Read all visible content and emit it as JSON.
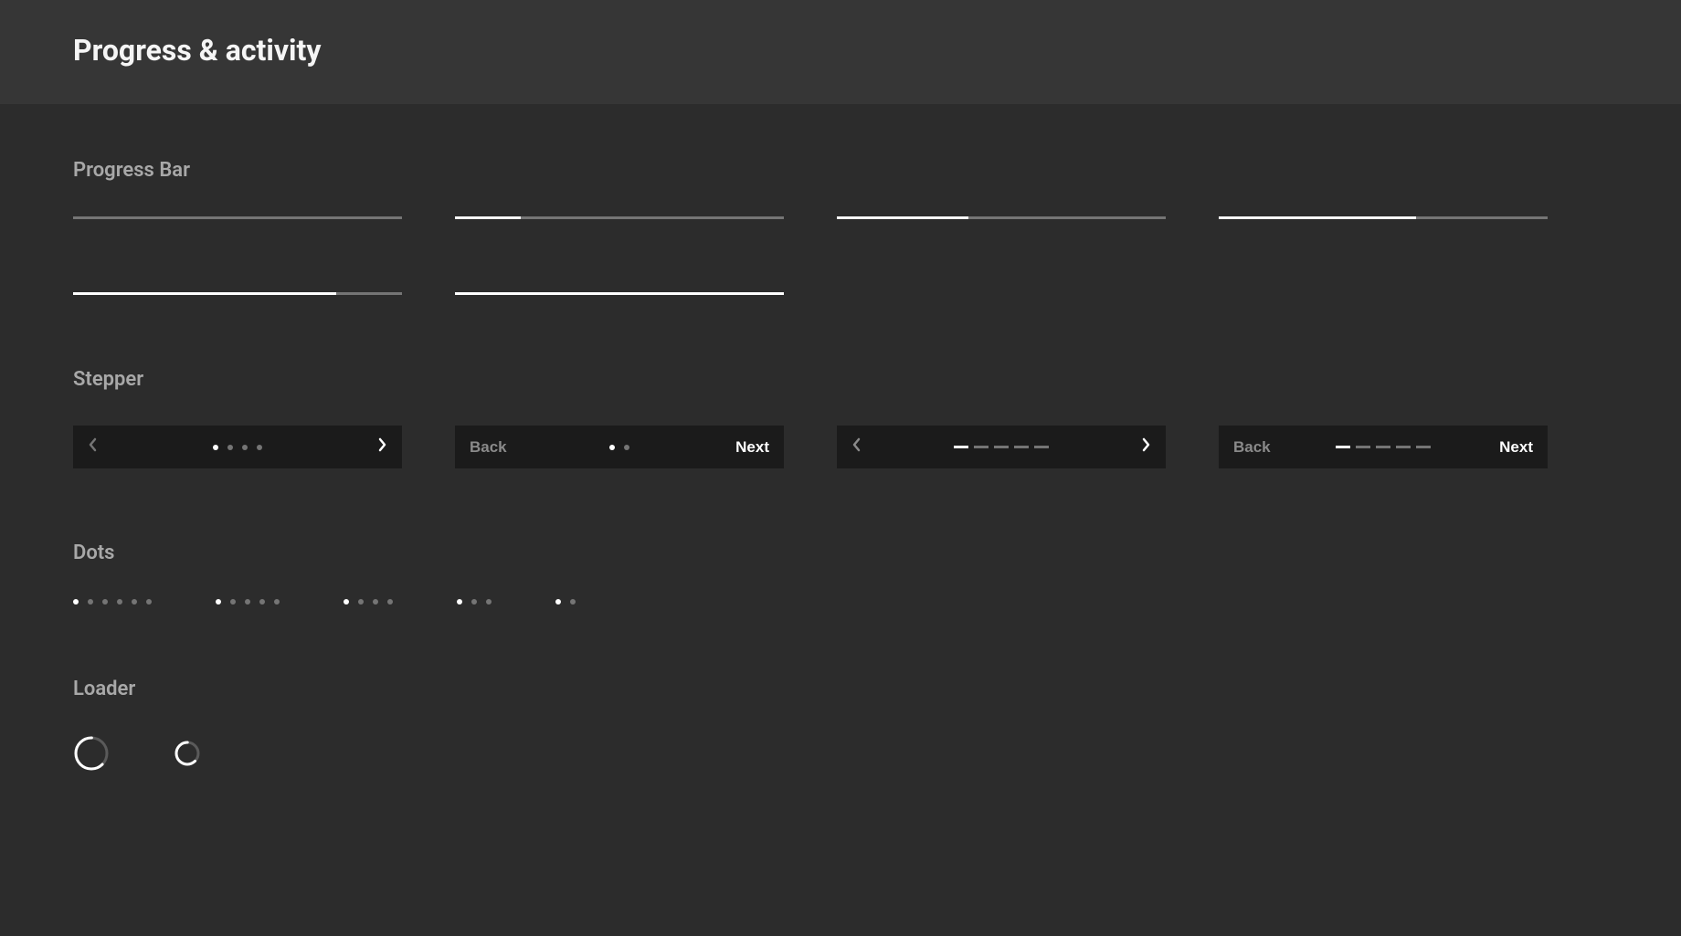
{
  "header": {
    "title": "Progress & activity"
  },
  "sections": {
    "progress_bar": {
      "title": "Progress Bar",
      "items": [
        {
          "percent": 0
        },
        {
          "percent": 20
        },
        {
          "percent": 40
        },
        {
          "percent": 60
        },
        {
          "percent": 80
        },
        {
          "percent": 100
        }
      ]
    },
    "stepper": {
      "title": "Stepper",
      "back_label": "Back",
      "next_label": "Next",
      "variants": [
        {
          "type": "dots",
          "nav_icons": true,
          "steps": 4,
          "current": 0,
          "back_disabled": true
        },
        {
          "type": "dots",
          "nav_icons": false,
          "steps": 2,
          "current": 0,
          "back_enabled": false
        },
        {
          "type": "bars",
          "nav_icons": true,
          "steps": 5,
          "current": 0,
          "segment_width": 16
        },
        {
          "type": "bars",
          "nav_icons": false,
          "steps": 5,
          "current": 0,
          "segment_width": 16
        }
      ]
    },
    "dots": {
      "title": "Dots",
      "variants": [
        {
          "count": 6,
          "active": 0
        },
        {
          "count": 5,
          "active": 0
        },
        {
          "count": 4,
          "active": 0
        },
        {
          "count": 3,
          "active": 0
        },
        {
          "count": 2,
          "active": 0
        }
      ]
    },
    "loader": {
      "title": "Loader",
      "variants": [
        {
          "size": 40
        },
        {
          "size": 30
        }
      ]
    }
  }
}
